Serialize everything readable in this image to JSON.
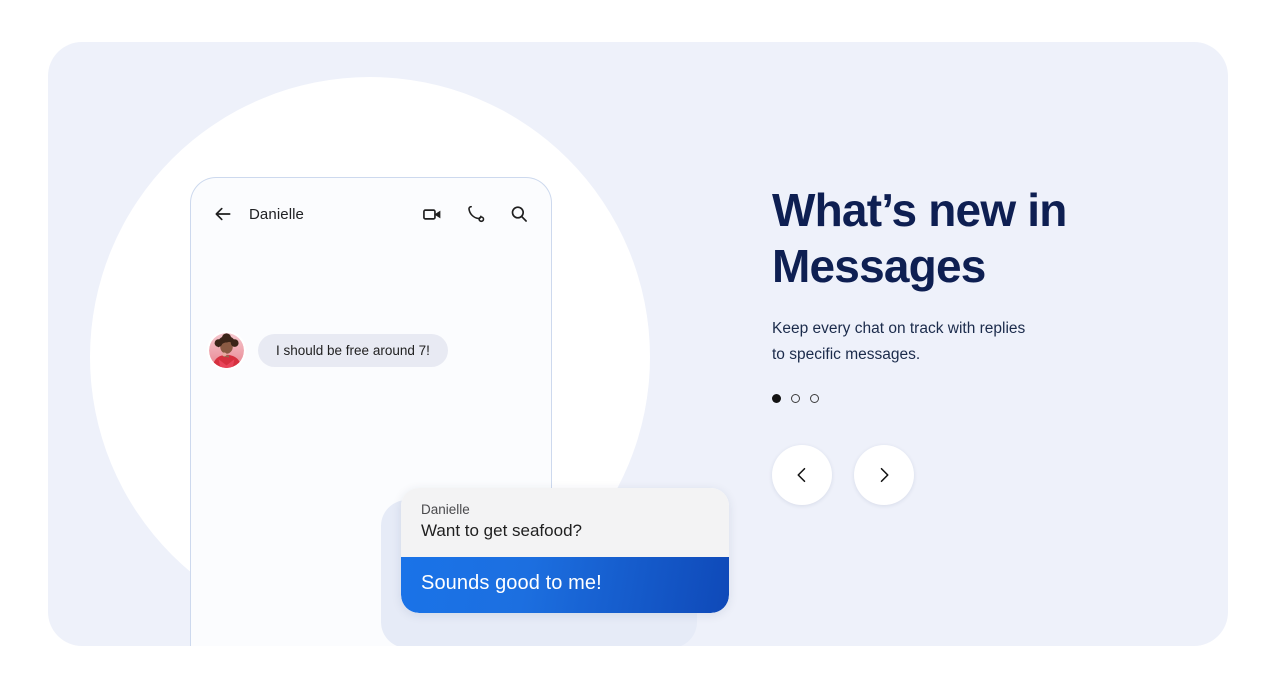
{
  "card": {
    "background_color": "#eef1fa"
  },
  "phone": {
    "appbar": {
      "back_icon": "back-arrow-icon",
      "title": "Danielle",
      "actions": [
        {
          "icon": "video-call-icon",
          "label": "Video call"
        },
        {
          "icon": "phone-call-icon",
          "label": "Call"
        },
        {
          "icon": "search-icon",
          "label": "Search"
        }
      ]
    },
    "messages": [
      {
        "type": "incoming",
        "avatar": "danielle-avatar",
        "text": "I should be free around 7!"
      }
    ],
    "reply_card": {
      "quoted": {
        "sender": "Danielle",
        "text": "Want to get seafood?"
      },
      "reply_text": "Sounds good to me!",
      "bubble_color_start": "#1a73e8",
      "bubble_color_end": "#0f49b8"
    }
  },
  "content": {
    "headline": "What’s new in\nMessages",
    "subhead": "Keep every chat on track with replies\nto specific messages.",
    "headline_color": "#0e1f52",
    "carousel": {
      "total": 3,
      "active_index": 0,
      "dots": [
        {
          "state": "active"
        },
        {
          "state": "inactive"
        },
        {
          "state": "inactive"
        }
      ],
      "prev_label": "Previous",
      "next_label": "Next"
    }
  }
}
